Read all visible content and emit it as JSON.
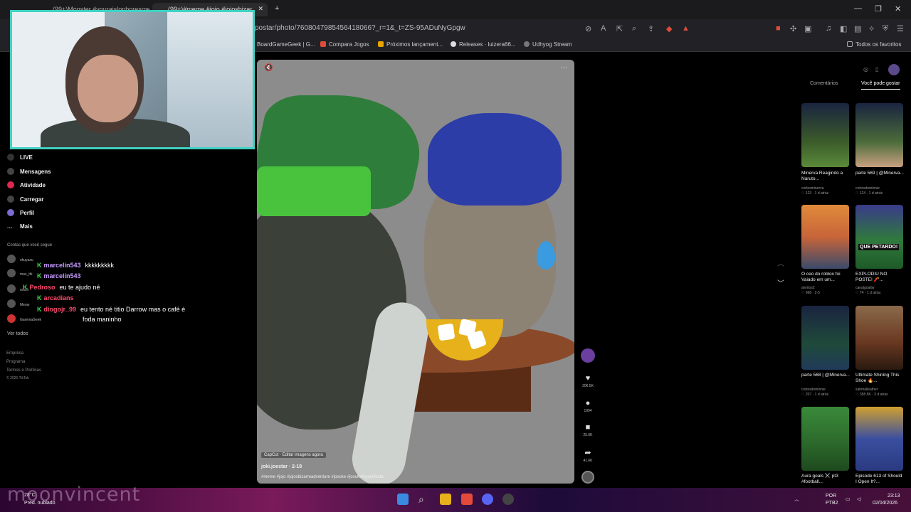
{
  "browser": {
    "tabs": [
      {
        "title": "(99+)Monster #vouraislopboresme #",
        "active": false
      },
      {
        "title": "(99+)#meme #jojo #jojosbizar",
        "active": true
      }
    ],
    "new_tab": "+",
    "url": "postar/photo/7608047985456418066?_r=1&_t=ZS-95ADuNyGpgw",
    "bookmarks": [
      {
        "label": "BoardGameGeek | G...",
        "color": "#555"
      },
      {
        "label": "Compara Jogos",
        "color": "#e24b3b"
      },
      {
        "label": "Próximos lançament...",
        "color": "#e7a400"
      },
      {
        "label": "Releases · luizera66...",
        "color": "#ddd"
      },
      {
        "label": "Udhyog Stream",
        "color": "#777"
      }
    ],
    "bookmarks_right": "Todos os favoritos",
    "window_controls": [
      "—",
      "❐",
      "✕"
    ]
  },
  "sidebar": {
    "items": [
      {
        "label": "LIVE",
        "icon": "live-icon"
      },
      {
        "label": "Mensagens",
        "icon": "messages-icon"
      },
      {
        "label": "Atividade",
        "icon": "activity-icon"
      },
      {
        "label": "Carregar",
        "icon": "upload-icon"
      },
      {
        "label": "Perfil",
        "icon": "profile-icon"
      },
      {
        "label": "Mais",
        "icon": "more-icon"
      }
    ],
    "following_title": "Contas que você segue",
    "accounts": [
      {
        "name": "okuyasu",
        "sub": "ko0****"
      },
      {
        "name": "max_ttk",
        "sub": "max.ttk"
      },
      {
        "name": "rosch",
        "sub": "canalcatholic"
      },
      {
        "name": "Meow",
        "sub": "meowcat"
      },
      {
        "name": "GaremaGeek",
        "sub": "gameageek"
      }
    ],
    "see_all": "Ver todos",
    "footer": [
      "Empresa",
      "Programa",
      "Termos e Políticas",
      "© 2026 TikTok"
    ]
  },
  "chat": [
    {
      "user": "marcelin543",
      "text": "kkkkkkkkk",
      "color": "#c79bff"
    },
    {
      "user": "marcelin543",
      "text": "",
      "color": "#c79bff"
    },
    {
      "user": "Pedroso",
      "text": "eu te ajudo né",
      "color": "#ff4b6e"
    },
    {
      "user": "arcadians",
      "text": "",
      "color": "#ff4b6e"
    },
    {
      "user": "diogojr_99",
      "text": "eu tento né titio Darrow mas o café é",
      "color": "#ff4b6e"
    },
    {
      "user": "",
      "text": "foda maninho",
      "color": "#ff4b6e"
    }
  ],
  "video": {
    "capcut": "CapCut · Editar imagens agora",
    "author": "joki.joestar · 2-18",
    "hashtags": "#meme #jojo #jojosbizarreadventure #josuke #josukehigashikata",
    "menu": "···"
  },
  "actions": [
    {
      "icon": "heart-icon",
      "glyph": "♥",
      "count": "206.5K"
    },
    {
      "icon": "comment-icon",
      "glyph": "●",
      "count": "1094"
    },
    {
      "icon": "bookmark-icon",
      "glyph": "■",
      "count": "25.6K"
    },
    {
      "icon": "share-icon",
      "glyph": "➦",
      "count": "41.6K"
    }
  ],
  "right_panel": {
    "tabs": [
      "Comentários",
      "Você pode gostar"
    ],
    "items": [
      {
        "title": "Minerva Reagindo a Naruto...",
        "author": "cortesminerva",
        "meta": "♡ 123 · 1 d atrás",
        "color": "#3b5b2a"
      },
      {
        "title": "parte 569 | @Minerva...",
        "author": "cortesdominnie",
        "meta": "♡ 124 · 1 d atrás",
        "color": "#4a6b3a"
      },
      {
        "title": "O ceo do roblox foi Vaiado em um...",
        "author": "alvritos2",
        "meta": "♡ 968 · 2-5",
        "color": "#c8653a"
      },
      {
        "title": "EXPLODIU NO POSTE! 🧨...",
        "author": "canalgoaltw",
        "meta": "♡ 74 · 1 d atrás",
        "color": "#2f7a3c"
      },
      {
        "title": "parte 568 | @Minerva...",
        "author": "cortesdominnie",
        "meta": "♡ 207 · 1 d atrás",
        "color": "#1f4a3a"
      },
      {
        "title": "Ultimate Shining This Shoe 🔥...",
        "author": "sahmalleather",
        "meta": "♡ 358.5K · 3 d atrás",
        "color": "#6b3a22"
      },
      {
        "title": "Aura goals ⚔️ pt3 #football...",
        "author": "",
        "meta": "",
        "color": "#2c6a2c"
      },
      {
        "title": "Episode 613 of Should I Open It?...",
        "author": "",
        "meta": "",
        "color": "#3a4fa0"
      }
    ],
    "thumb_label": "QUE PETARDO!"
  },
  "taskbar": {
    "weather_temp": "28°C",
    "weather_desc": "Pred. nublado",
    "overlay": "moonvincent",
    "lang": "POR",
    "lang2": "PTB2",
    "time": "23:13",
    "date": "02/04/2026"
  }
}
